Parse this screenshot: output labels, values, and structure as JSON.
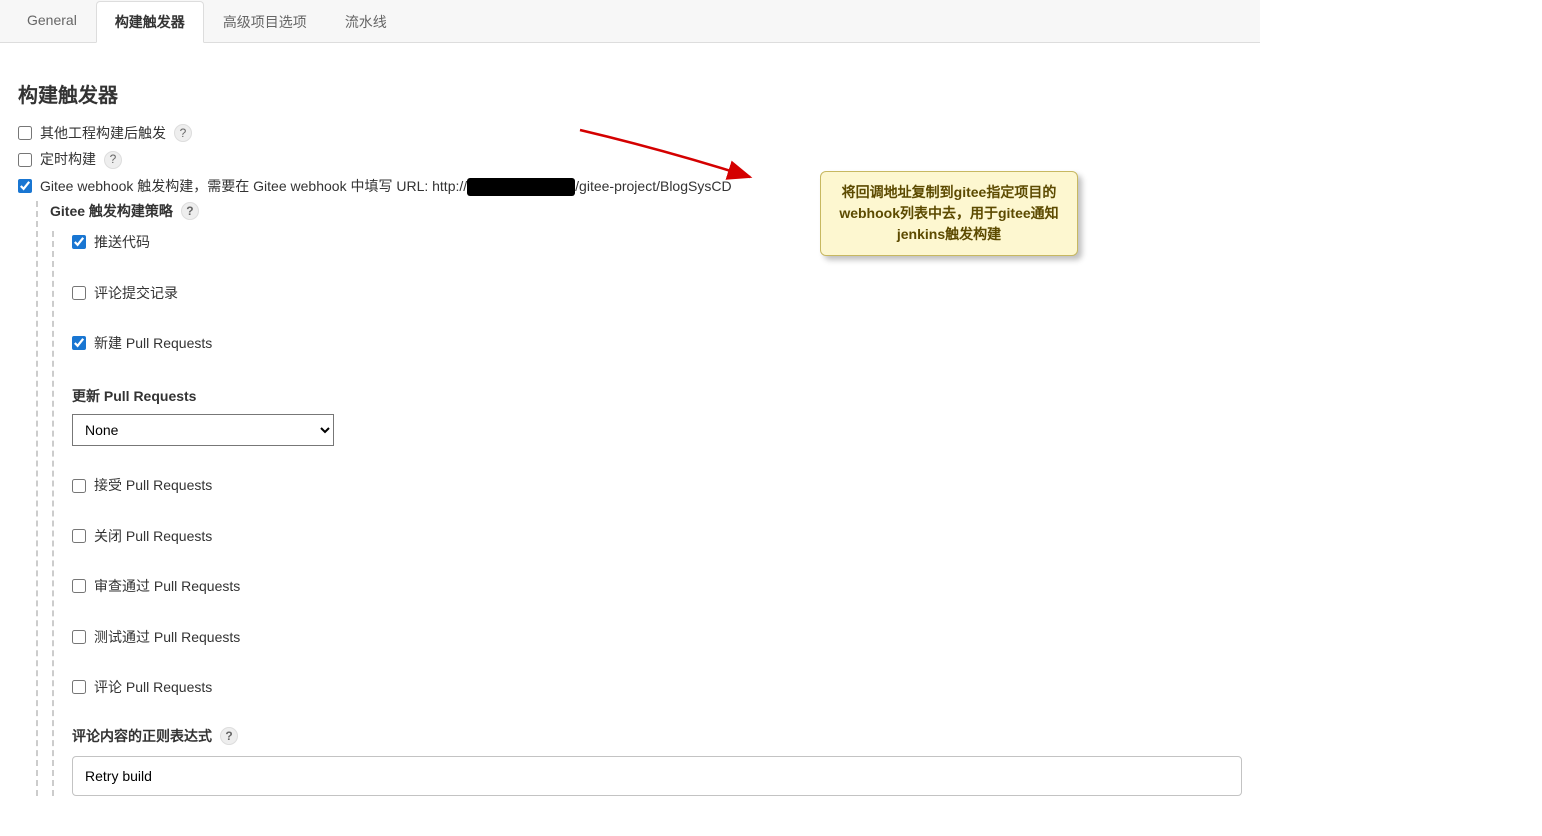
{
  "tabs": {
    "general": "General",
    "triggers": "构建触发器",
    "advanced": "高级项目选项",
    "pipeline": "流水线"
  },
  "section": {
    "title": "构建触发器"
  },
  "options": {
    "after_other": "其他工程构建后触发",
    "scheduled": "定时构建",
    "gitee_webhook_prefix": "Gitee webhook 触发构建，需要在 Gitee webhook 中填写 URL: http://",
    "gitee_webhook_suffix": "/gitee-project/BlogSysCD",
    "strategy_label": "Gitee 触发构建策略",
    "push_code": "推送代码",
    "comment_commit": "评论提交记录",
    "new_pr": "新建 Pull Requests",
    "update_pr_label": "更新 Pull Requests",
    "update_pr_value": "None",
    "accept_pr": "接受 Pull Requests",
    "close_pr": "关闭 Pull Requests",
    "review_pass_pr": "审查通过 Pull Requests",
    "test_pass_pr": "测试通过 Pull Requests",
    "comment_pr": "评论 Pull Requests",
    "regex_label": "评论内容的正则表达式",
    "regex_value": "Retry build"
  },
  "annotation": {
    "text": "将回调地址复制到gitee指定项目的webhook列表中去，用于gitee通知jenkins触发构建"
  },
  "help_glyph": "?"
}
